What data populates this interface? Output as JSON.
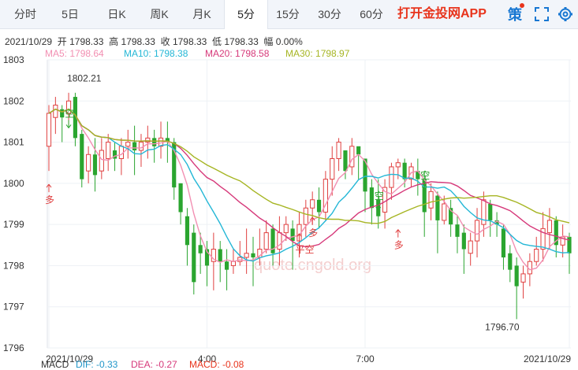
{
  "tabs": [
    {
      "label": "分时"
    },
    {
      "label": "5日"
    },
    {
      "label": "日K"
    },
    {
      "label": "周K"
    },
    {
      "label": "月K"
    },
    {
      "label": "5分",
      "active": true
    },
    {
      "label": "15分"
    },
    {
      "label": "30分"
    },
    {
      "label": "60分"
    }
  ],
  "app_link": "打开金投网APP",
  "icons": {
    "brand": "策",
    "fullscreen": "fullscreen-icon",
    "settings": "gear-icon"
  },
  "info": {
    "date": "2021/10/29",
    "open_label": "开",
    "open": "1798.33",
    "high_label": "高",
    "high": "1798.33",
    "close_label": "收",
    "close": "1798.33",
    "low_label": "低",
    "low": "1798.33",
    "amp_label": "幅",
    "amp": "0.00%"
  },
  "ma_legend": [
    {
      "label": "MA5: 1798.64",
      "color": "#f28fb2"
    },
    {
      "label": "MA10: 1798.38",
      "color": "#24b7d6"
    },
    {
      "label": "MA20: 1798.58",
      "color": "#d6397a"
    },
    {
      "label": "MA30: 1798.97",
      "color": "#a6b523"
    }
  ],
  "watermark": "quote.cngold.org",
  "bottom_indicators": [
    {
      "label": "MACD",
      "color": "#333333"
    },
    {
      "label": "DIF: -0.33",
      "color": "#2196c9"
    },
    {
      "label": "DEA: -0.27",
      "color": "#d6397a"
    },
    {
      "label": "MACD: -0.08",
      "color": "#e8341c"
    }
  ],
  "chart_data": {
    "type": "candlestick",
    "y_ticks": [
      "1803",
      "1802",
      "1801",
      "1800",
      "1799",
      "1798",
      "1797",
      "1796"
    ],
    "ylim": [
      1796,
      1803
    ],
    "x_labels": [
      {
        "label": "2021/10/29",
        "index": 0
      },
      {
        "label": "4:00",
        "index": 24
      },
      {
        "label": "7:00",
        "index": 48
      },
      {
        "label": "2021/10/29",
        "index": 79
      }
    ],
    "annotations": [
      {
        "text": "1802.21",
        "index": 3,
        "value": 1802.21,
        "pos": "above"
      },
      {
        "text": "1796.70",
        "index": 71,
        "value": 1796.7,
        "pos": "below"
      }
    ],
    "signals": [
      {
        "text": "多",
        "index": 0,
        "value": 1799.9,
        "dir": "up"
      },
      {
        "text": "空",
        "index": 3,
        "value": 1801.5,
        "dir": "down"
      },
      {
        "text": "平空",
        "index": 38,
        "value": 1798.7,
        "dir": "up"
      },
      {
        "text": "多",
        "index": 40,
        "value": 1799.1,
        "dir": "up"
      },
      {
        "text": "空",
        "index": 50,
        "value": 1799.5,
        "dir": "down"
      },
      {
        "text": "多",
        "index": 53,
        "value": 1798.8,
        "dir": "up"
      },
      {
        "text": "空",
        "index": 57,
        "value": 1800.0,
        "dir": "down"
      }
    ],
    "candles": [
      [
        1800.9,
        1801.7,
        1800.3,
        1801.9
      ],
      [
        1801.6,
        1801.9,
        1801.2,
        1802.1
      ],
      [
        1801.8,
        1801.6,
        1801.0,
        1801.9
      ],
      [
        1801.7,
        1802.0,
        1801.4,
        1802.2
      ],
      [
        1802.1,
        1801.1,
        1800.9,
        1802.2
      ],
      [
        1801.2,
        1800.1,
        1799.9,
        1801.3
      ],
      [
        1800.3,
        1800.7,
        1800.0,
        1800.9
      ],
      [
        1800.7,
        1800.2,
        1799.8,
        1801.1
      ],
      [
        1800.3,
        1800.8,
        1800.1,
        1801.1
      ],
      [
        1800.6,
        1801.0,
        1800.3,
        1801.2
      ],
      [
        1800.8,
        1800.6,
        1800.3,
        1801.0
      ],
      [
        1800.6,
        1800.9,
        1800.2,
        1801.1
      ],
      [
        1800.9,
        1801.0,
        1800.6,
        1801.3
      ],
      [
        1801.0,
        1800.8,
        1800.2,
        1801.4
      ],
      [
        1800.8,
        1801.0,
        1800.4,
        1801.2
      ],
      [
        1801.0,
        1801.1,
        1800.6,
        1801.4
      ],
      [
        1801.1,
        1800.9,
        1800.5,
        1801.3
      ],
      [
        1800.9,
        1801.1,
        1800.6,
        1801.5
      ],
      [
        1801.1,
        1801.0,
        1800.5,
        1801.5
      ],
      [
        1801.0,
        1799.9,
        1799.6,
        1801.1
      ],
      [
        1800.0,
        1799.3,
        1799.0,
        1800.0
      ],
      [
        1799.2,
        1798.5,
        1798.0,
        1799.4
      ],
      [
        1798.8,
        1797.6,
        1797.3,
        1799.0
      ],
      [
        1798.5,
        1798.3,
        1797.8,
        1798.8
      ],
      [
        1798.4,
        1798.0,
        1797.5,
        1798.6
      ],
      [
        1798.1,
        1798.4,
        1797.4,
        1798.8
      ],
      [
        1798.4,
        1798.1,
        1797.6,
        1798.6
      ],
      [
        1798.1,
        1797.9,
        1797.4,
        1798.4
      ],
      [
        1798.0,
        1798.1,
        1797.8,
        1798.4
      ],
      [
        1798.1,
        1798.2,
        1798.0,
        1798.6
      ],
      [
        1798.2,
        1798.3,
        1797.8,
        1798.9
      ],
      [
        1798.3,
        1798.2,
        1797.5,
        1798.7
      ],
      [
        1798.2,
        1798.4,
        1798.0,
        1798.9
      ],
      [
        1798.4,
        1798.8,
        1798.3,
        1799.1
      ],
      [
        1798.9,
        1798.3,
        1798.0,
        1799.0
      ],
      [
        1798.4,
        1798.8,
        1798.0,
        1799.2
      ],
      [
        1798.8,
        1799.0,
        1798.6,
        1799.2
      ],
      [
        1798.9,
        1798.6,
        1797.9,
        1799.1
      ],
      [
        1798.6,
        1799.0,
        1798.2,
        1799.3
      ],
      [
        1799.0,
        1799.4,
        1798.7,
        1799.6
      ],
      [
        1799.4,
        1799.6,
        1799.0,
        1799.8
      ],
      [
        1799.6,
        1799.3,
        1798.9,
        1799.9
      ],
      [
        1799.3,
        1800.1,
        1799.1,
        1800.3
      ],
      [
        1800.1,
        1800.6,
        1799.7,
        1800.9
      ],
      [
        1800.6,
        1801.0,
        1800.3,
        1801.1
      ],
      [
        1800.8,
        1800.3,
        1800.1,
        1800.8
      ],
      [
        1800.4,
        1800.9,
        1800.2,
        1801.1
      ],
      [
        1800.9,
        1800.7,
        1800.1,
        1800.8
      ],
      [
        1800.6,
        1799.8,
        1799.3,
        1800.6
      ],
      [
        1799.9,
        1799.4,
        1799.0,
        1800.1
      ],
      [
        1799.6,
        1799.2,
        1798.9,
        1800.1
      ],
      [
        1799.3,
        1799.9,
        1798.9,
        1800.1
      ],
      [
        1799.9,
        1800.4,
        1799.6,
        1800.5
      ],
      [
        1800.4,
        1800.5,
        1800.1,
        1800.6
      ],
      [
        1800.5,
        1800.1,
        1799.9,
        1800.6
      ],
      [
        1800.1,
        1800.4,
        1799.9,
        1800.5
      ],
      [
        1800.3,
        1800.1,
        1799.7,
        1800.6
      ],
      [
        1800.1,
        1799.3,
        1798.7,
        1800.3
      ],
      [
        1799.4,
        1799.8,
        1799.1,
        1800.0
      ],
      [
        1799.7,
        1799.1,
        1798.3,
        1799.8
      ],
      [
        1799.1,
        1799.5,
        1799.0,
        1799.7
      ],
      [
        1799.4,
        1799.0,
        1798.7,
        1799.6
      ],
      [
        1799.0,
        1798.7,
        1798.3,
        1799.2
      ],
      [
        1798.8,
        1798.4,
        1797.8,
        1799.0
      ],
      [
        1798.3,
        1798.6,
        1798.0,
        1798.8
      ],
      [
        1798.6,
        1799.1,
        1798.2,
        1799.4
      ],
      [
        1799.0,
        1799.6,
        1798.7,
        1799.8
      ],
      [
        1799.5,
        1799.1,
        1798.7,
        1799.6
      ],
      [
        1799.1,
        1799.0,
        1798.7,
        1799.3
      ],
      [
        1798.9,
        1798.2,
        1797.9,
        1799.0
      ],
      [
        1798.3,
        1797.9,
        1797.6,
        1798.5
      ],
      [
        1798.0,
        1797.5,
        1796.7,
        1798.2
      ],
      [
        1797.6,
        1797.8,
        1797.2,
        1798.0
      ],
      [
        1797.8,
        1798.1,
        1797.5,
        1798.3
      ],
      [
        1798.1,
        1798.4,
        1798.0,
        1798.7
      ],
      [
        1798.4,
        1798.9,
        1798.1,
        1799.3
      ],
      [
        1798.8,
        1799.1,
        1798.4,
        1799.4
      ],
      [
        1799.1,
        1798.5,
        1798.2,
        1799.2
      ],
      [
        1798.5,
        1798.7,
        1798.2,
        1799.0
      ],
      [
        1798.7,
        1798.3,
        1797.8,
        1798.8
      ]
    ]
  }
}
